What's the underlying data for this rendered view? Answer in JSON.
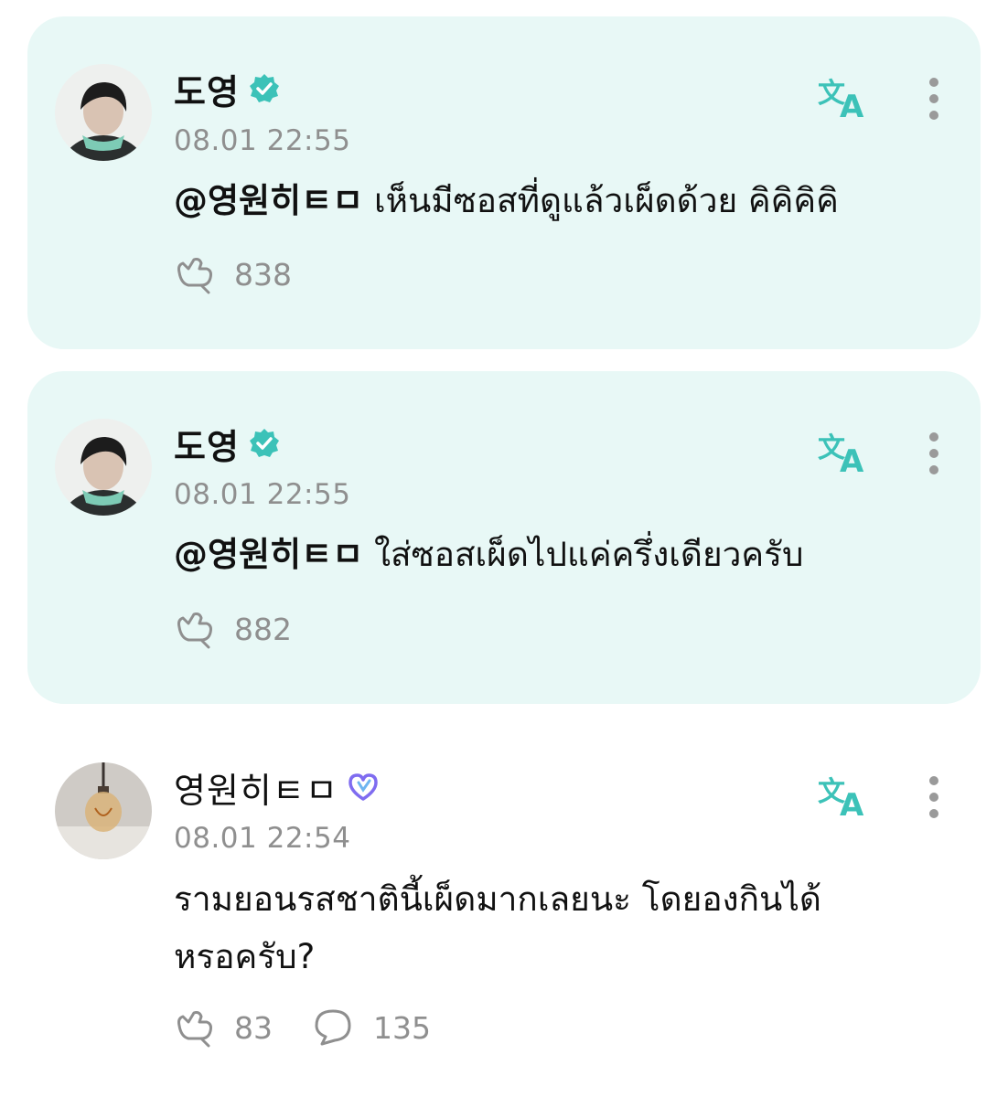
{
  "comments": [
    {
      "author": "도영",
      "verified": true,
      "time": "08.01 22:55",
      "mention": "@영원히ㅌㅁ",
      "text": "เห็นมีซอสที่ดูแล้วเผ็ดด้วย คิคิคิคิ",
      "likes": "838",
      "highlighted": true
    },
    {
      "author": "도영",
      "verified": true,
      "time": "08.01 22:55",
      "mention": "@영원히ㅌㅁ",
      "text": "ใส่ซอสเผ็ดไปแค่ครึ่งเดียวครับ",
      "likes": "882",
      "highlighted": true
    },
    {
      "author": "영원히ㅌㅁ",
      "verified": false,
      "time": "08.01 22:54",
      "text_line1": "รามยอนรสชาตินี้เผ็ดมากเลยนะ โดยองกินได้",
      "text_line2": "หรอครับ?",
      "likes": "83",
      "replies": "135",
      "highlighted": false
    }
  ],
  "colors": {
    "card_bg": "#e8f8f6",
    "accent": "#3cc2b8",
    "muted": "#8f8f8f",
    "text": "#111111",
    "fan_badge": "#7f6cf0"
  },
  "icons": [
    "verified-badge-icon",
    "translate-icon",
    "more-options-icon",
    "like-icon",
    "reply-icon",
    "fan-heart-icon"
  ]
}
